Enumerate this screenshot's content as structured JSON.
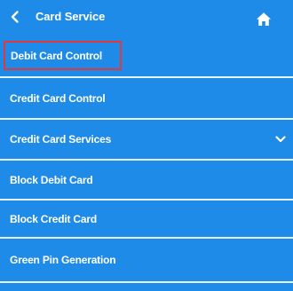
{
  "header": {
    "title": "Card Service",
    "back_icon": "chevron-left-icon",
    "home_icon": "home-icon"
  },
  "menu": {
    "items": [
      {
        "label": "Debit Card Control",
        "selected": true
      },
      {
        "label": "Credit Card Control"
      },
      {
        "label": "Credit Card Services",
        "icon": "chevron-down-icon"
      },
      {
        "label": "Block Debit Card"
      },
      {
        "label": "Block Credit Card"
      },
      {
        "label": "Green Pin Generation"
      }
    ]
  },
  "colors": {
    "background": "#1f8be8",
    "text": "#ffffff",
    "divider": "#eaf3fb",
    "highlight": "#e03a3a"
  }
}
